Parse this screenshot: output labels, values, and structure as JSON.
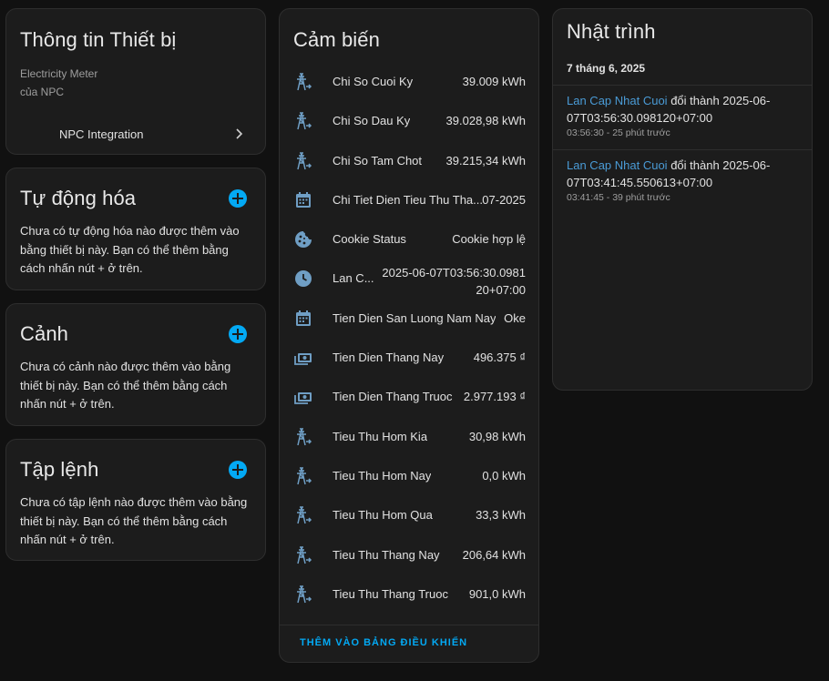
{
  "device_info": {
    "title": "Thông tin Thiết bị",
    "model": "Electricity Meter",
    "manufacturer": "của NPC",
    "integration_label": "NPC Integration"
  },
  "automation": {
    "title": "Tự động hóa",
    "description": "Chưa có tự động hóa nào được thêm vào bằng thiết bị này. Bạn có thể thêm bằng cách nhấn nút + ở trên."
  },
  "scene": {
    "title": "Cảnh",
    "description": "Chưa có cảnh nào được thêm vào bằng thiết bị này. Bạn có thể thêm bằng cách nhấn nút + ở trên."
  },
  "script": {
    "title": "Tập lệnh",
    "description": "Chưa có tập lệnh nào được thêm vào bằng thiết bị này. Bạn có thể thêm bằng cách nhấn nút + ở trên."
  },
  "sensors": {
    "title": "Cảm biến",
    "add_to_dashboard": "THÊM VÀO BẢNG ĐIỀU KHIỂN",
    "items": [
      {
        "icon": "transmission-tower-icon",
        "name": "Chi So Cuoi Ky",
        "value": "39.009 kWh"
      },
      {
        "icon": "transmission-tower-icon",
        "name": "Chi So Dau Ky",
        "value": "39.028,98 kWh"
      },
      {
        "icon": "transmission-tower-icon",
        "name": "Chi So Tam Chot",
        "value": "39.215,34 kWh"
      },
      {
        "icon": "calendar-icon",
        "name": "Chi Tiet Dien Tieu Thu Tha...",
        "value": "07-2025"
      },
      {
        "icon": "cookie-icon",
        "name": "Cookie Status",
        "value": "Cookie hợp lệ"
      },
      {
        "icon": "clock-icon",
        "name": "Lan C...",
        "value": "2025-06-07T03:56:30.098120+07:00"
      },
      {
        "icon": "calendar-icon",
        "name": "Tien Dien San Luong Nam Nay",
        "value": "Oke"
      },
      {
        "icon": "cash-icon",
        "name": "Tien Dien Thang Nay",
        "value": "496.375 ₫"
      },
      {
        "icon": "cash-icon",
        "name": "Tien Dien Thang Truoc",
        "value": "2.977.193 ₫"
      },
      {
        "icon": "transmission-tower-icon",
        "name": "Tieu Thu Hom Kia",
        "value": "30,98 kWh"
      },
      {
        "icon": "transmission-tower-icon",
        "name": "Tieu Thu Hom Nay",
        "value": "0,0 kWh"
      },
      {
        "icon": "transmission-tower-icon",
        "name": "Tieu Thu Hom Qua",
        "value": "33,3 kWh"
      },
      {
        "icon": "transmission-tower-icon",
        "name": "Tieu Thu Thang Nay",
        "value": "206,64 kWh"
      },
      {
        "icon": "transmission-tower-icon",
        "name": "Tieu Thu Thang Truoc",
        "value": "901,0 kWh"
      }
    ]
  },
  "logbook": {
    "title": "Nhật trình",
    "date": "7 tháng 6, 2025",
    "entries": [
      {
        "entity": "Lan Cap Nhat Cuoi",
        "message": " đổi thành 2025-06-07T03:56:30.098120+07:00",
        "time": "03:56:30 - 25 phút trước"
      },
      {
        "entity": "Lan Cap Nhat Cuoi",
        "message": " đổi thành 2025-06-07T03:41:45.550613+07:00",
        "time": "03:41:45 - 39 phút trước"
      }
    ]
  },
  "colors": {
    "accent": "#03a9f4",
    "icon": "#6f9ec4",
    "link": "#4a9bd6"
  }
}
